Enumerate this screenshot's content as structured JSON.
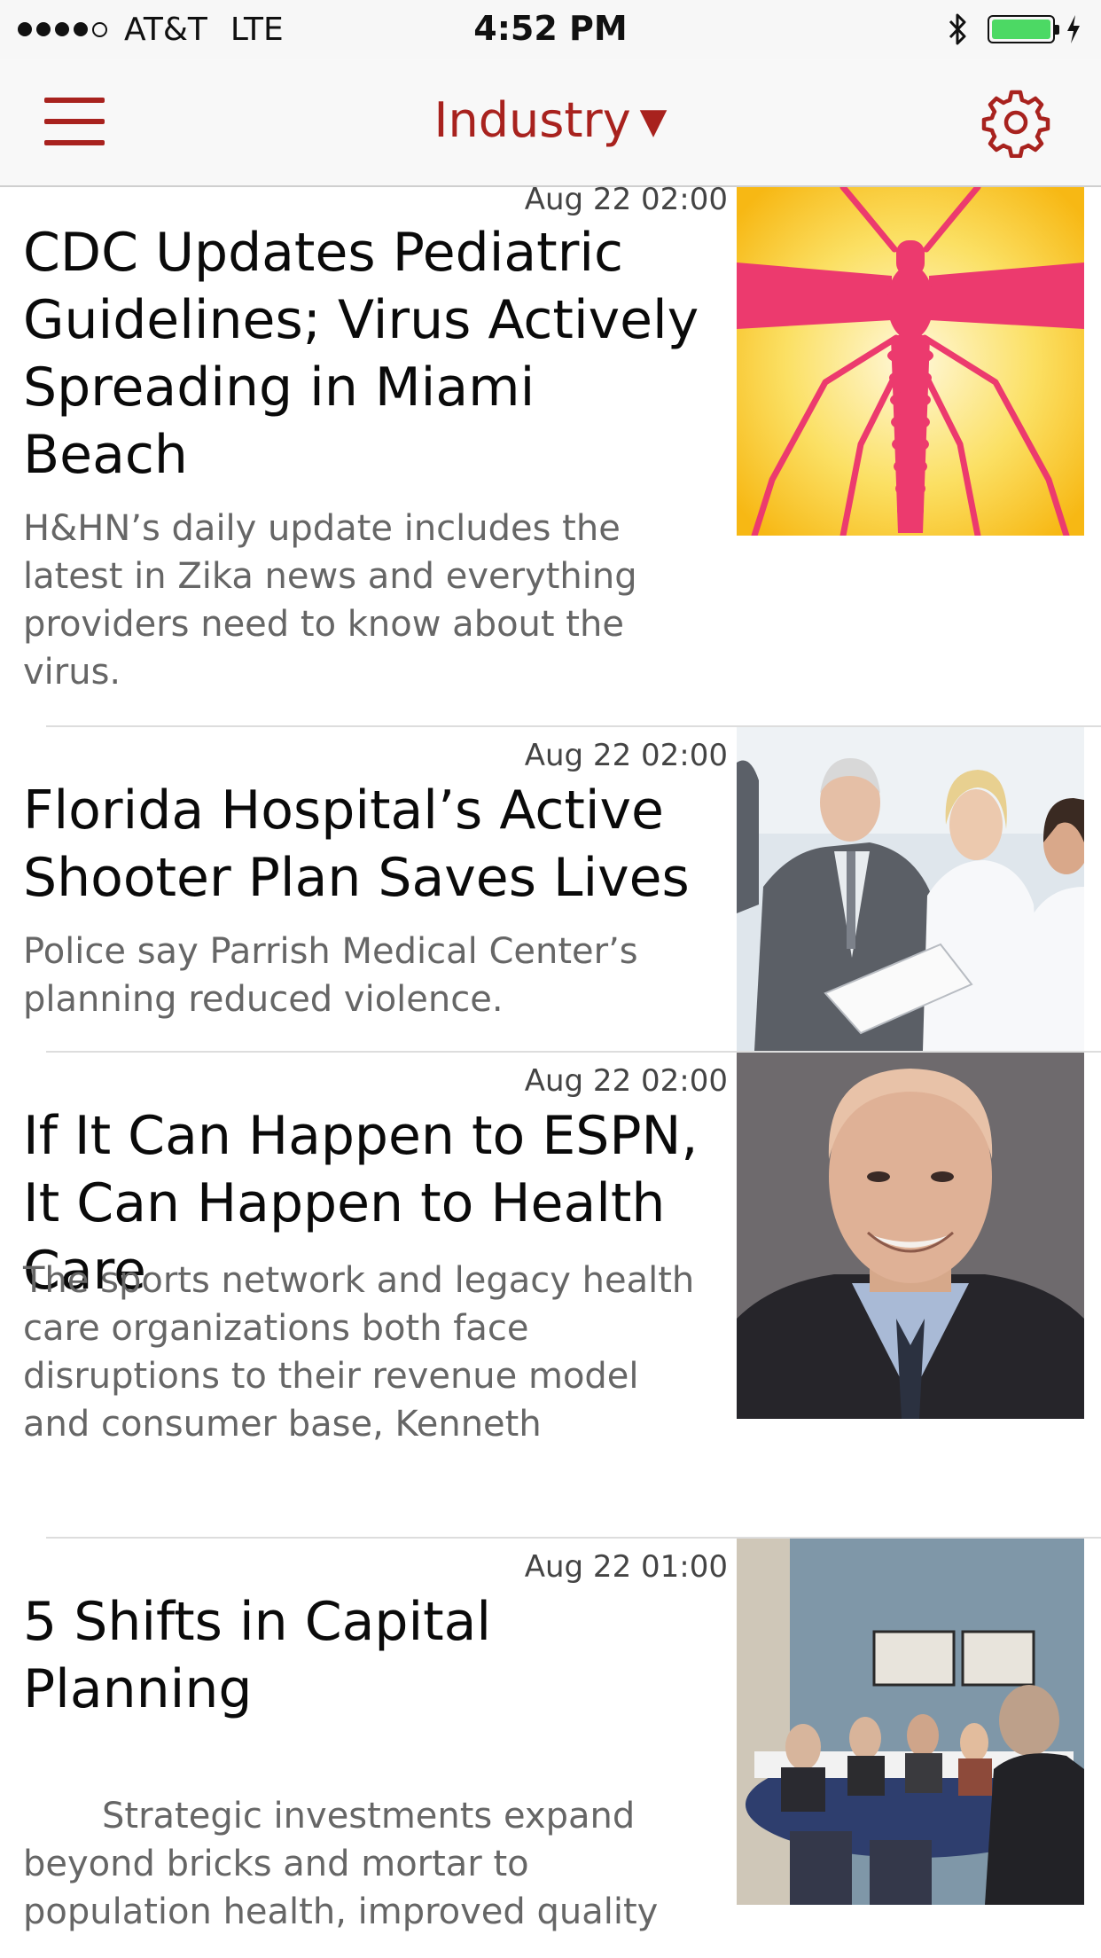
{
  "status_bar": {
    "carrier": "AT&T",
    "network": "LTE",
    "time": "4:52 PM",
    "signal_bars": 4,
    "signal_max": 5,
    "battery_level": 1.0
  },
  "nav": {
    "title": "Industry",
    "dropdown_icon": "caret-down-icon",
    "menu_icon": "hamburger-menu-icon",
    "settings_icon": "gear-icon",
    "accent_color": "#a8221e"
  },
  "articles": [
    {
      "date": "Aug 22 02:00",
      "headline": "CDC Updates Pediatric Guidelines; Virus Actively Spreading in Miami Beach",
      "summary": "H&HN’s  daily update includes the latest in Zika news and everything providers need to know about the virus.",
      "image": "mosquito-illustration"
    },
    {
      "date": "Aug 22 02:00",
      "headline": "Florida Hospital’s Active Shooter Plan Saves Lives",
      "summary": "Police say Parrish Medical Center’s planning reduced violence.",
      "image": "doctors-with-clipboard-photo"
    },
    {
      "date": "Aug 22 02:00",
      "headline": "If It Can Happen to ESPN, It Can Happen to Health Care",
      "summary": "The sports network and legacy health care organizations both face disruptions to their revenue model and consumer base, Kenneth",
      "image": "man-headshot-photo"
    },
    {
      "date": "Aug 22 01:00",
      "headline": "5 Shifts in Capital Planning",
      "summary": "       Strategic investments expand beyond bricks and mortar to population health, improved quality",
      "image": "conference-meeting-photo"
    }
  ]
}
